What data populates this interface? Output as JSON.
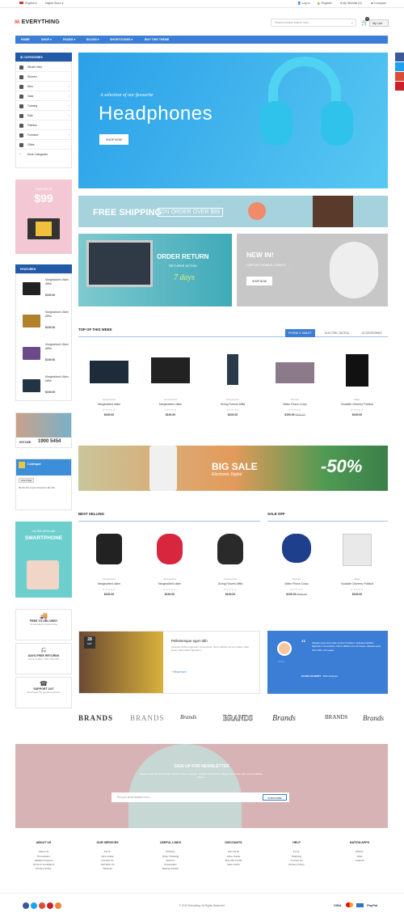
{
  "topbar": {
    "language": "English",
    "store": "Digital Store",
    "login": "Log In",
    "register": "Register",
    "wishlist": "My Wishlist (0)",
    "compare": "Compare"
  },
  "header": {
    "logo": "EVERYTHING",
    "search_placeholder": "Search product search here...",
    "cart_label": "My Cart",
    "cart_count": "0"
  },
  "nav": {
    "items": [
      "HOME",
      "SHOP",
      "PAGES",
      "BLOGS",
      "SHORTCODES",
      "BUY THIS THEME"
    ]
  },
  "categories": {
    "title": "CATEGORIES",
    "items": [
      "What's New",
      "Women",
      "Men",
      "Gear",
      "Training",
      "Sale",
      "Fashion",
      "Furniture",
      "Cities",
      "More Categories"
    ]
  },
  "promo_side": {
    "starting": "STARTING AT",
    "price": "$99"
  },
  "featured": {
    "title": "FEATURED",
    "items": [
      {
        "name": "Marginalized Ullam Afffia",
        "price": "$100.00"
      },
      {
        "name": "Marginalized Ullam Afffia",
        "price": "$100.00"
      },
      {
        "name": "Marginalized Ullam Afffia",
        "price": "$100.00"
      },
      {
        "name": "Marginalized Ullam Afffia",
        "price": "$100.00"
      }
    ]
  },
  "hotline": {
    "label": "HOTLINE:",
    "number": "1900 5454"
  },
  "social_box": {
    "name": "Codespot",
    "like": "Like Page",
    "text": "Be the first of your friends to like this"
  },
  "smartphone": {
    "line1": "Get 30% off the sale",
    "title": "SMARTPHONE"
  },
  "services": [
    {
      "title": "FREE TO DELIVERY",
      "sub": "On all order for online shop"
    },
    {
      "title": "DAYS FREE RETURNS",
      "sub": "Get up to 30%. TWO 70% OFF"
    },
    {
      "title": "SUPPORT 24/7",
      "sub": "We answer the questions all time"
    }
  ],
  "hero": {
    "small": "A selection of our favourite",
    "title": "Headphones",
    "button": "SHOP NOW"
  },
  "shipping": {
    "title": "FREE SHIPPING",
    "sub": "ON ORDER OVER $99"
  },
  "order_return": {
    "title": "ORDER RETURN",
    "sub": "RETURNS WITHIN",
    "days": "7 days"
  },
  "new_in": {
    "title": "NEW IN!",
    "sub": "LAPTOP, MOBILE, TABLET ...",
    "button": "SHOP NOW"
  },
  "top_week": {
    "title": "TOP OF THIS WEEK",
    "tabs": [
      "PHONE & TABLET",
      "ELECTRIC DIGITAL",
      "ACCESSORIES"
    ],
    "products": [
      {
        "cat": "Accessories",
        "name": "Marginalized ullam",
        "price": "$100.00",
        "old": ""
      },
      {
        "cat": "Accessories",
        "name": "Marginalized ullam",
        "price": "$100.00",
        "old": ""
      },
      {
        "cat": "Accessories",
        "name": "Giving Futures Afffia",
        "price": "$100.00",
        "old": ""
      },
      {
        "cat": "Women",
        "name": "Water Peace Corps",
        "price": "$100.00",
        "old": "$300.00"
      },
      {
        "cat": "Bags",
        "name": "Scalable Citizenry Political",
        "price": "$100.00",
        "old": ""
      }
    ]
  },
  "big_sale": {
    "title": "BIG SALE",
    "sub": "Electronic Digital",
    "discount": "-50%"
  },
  "best_selling": {
    "title": "BEST SELLING",
    "products": [
      {
        "cat": "Accessories",
        "name": "Marginalized ullam",
        "price": "$100.00",
        "old": ""
      },
      {
        "cat": "Accessories",
        "name": "Marginalized ullam",
        "price": "$100.00",
        "old": ""
      },
      {
        "cat": "Accessories",
        "name": "Giving Futures Afffia",
        "price": "$100.00",
        "old": ""
      }
    ]
  },
  "sale_off": {
    "title": "SALE OFF",
    "products": [
      {
        "cat": "Women",
        "name": "Water Peace Corps",
        "price": "$100.00",
        "old": "$300.00"
      },
      {
        "cat": "Bags",
        "name": "Scalable Citizenry Political",
        "price": "$100.00",
        "old": ""
      }
    ]
  },
  "blog": {
    "day": "28",
    "month": "MAY",
    "title": "Pellentesque eget nibh",
    "text": "Quisque finibus dignissim consectetur. Nunc efficitur est vel neque. Nam ipsum dolor tellus dignissim...",
    "more": "Read more"
  },
  "testimonial": {
    "text": "Aliquam quis char ulam id sem tincidunt. Quisque facilisis dignissim consectetur. Nunc efficitur est vel neque. Aliquam quis char ulam vel neque.",
    "author": "ELENA GILBERT",
    "role": "Web designer"
  },
  "brands": [
    "BRANDS",
    "BRANDS",
    "Brands",
    "BRANDS",
    "Brands",
    "BRANDS",
    "Brands"
  ],
  "newsletter": {
    "title": "SIGN UP FOR NEWSLETTER",
    "text": "Aliquam eget dui vitae id sem efficitur ultrices aliquam. Integer varius lorem. Aliquam quis char ulam id sem efficitur ultrices.",
    "placeholder": "Put your email address here...",
    "button": "SUBSCRIBE"
  },
  "footer": [
    {
      "title": "ABOUT US",
      "items": [
        "About Us",
        "Promotions",
        "Affiliate Program",
        "Terms & Conditions",
        "Privacy Policy"
      ]
    },
    {
      "title": "OUR SERVICES",
      "items": [
        "F.A.Q.",
        "Size Guide",
        "Contact Us",
        "Sell With Us",
        "Sitemap"
      ]
    },
    {
      "title": "USEFUL LINKS",
      "items": [
        "Delivery",
        "Order Tracking",
        "Returns",
        "E-Receipts",
        "Buying Guides"
      ]
    },
    {
      "title": "DISCOUNTS",
      "items": [
        "Gift Cards",
        "Store Cards",
        "Buy Gift Cards",
        "Sale Cards"
      ]
    },
    {
      "title": "HELP",
      "items": [
        "F.A.Q.",
        "Shipping",
        "Contact Us",
        "Privacy Policy"
      ]
    },
    {
      "title": "NATION APPS",
      "items": [
        "iPhone",
        "iPad",
        "Android"
      ]
    }
  ],
  "copyright": "© 2016 Everything. All Rights Reserved.",
  "payments": [
    "VISA",
    "PayPal"
  ],
  "colors": {
    "accent": "#3c7ed6",
    "dark_blue": "#235aa8"
  }
}
